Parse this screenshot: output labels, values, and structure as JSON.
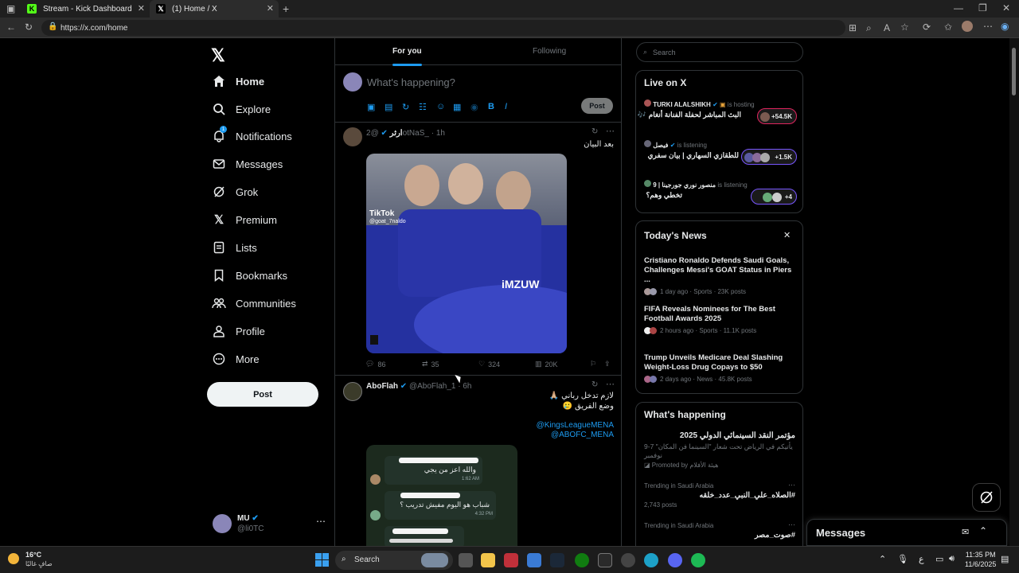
{
  "browser": {
    "tabs": [
      {
        "title": "Stream - Kick Dashboard",
        "active": false
      },
      {
        "title": "(1) Home / X",
        "active": true
      }
    ],
    "url": "https://x.com/home"
  },
  "nav": {
    "items": [
      {
        "label": "Home",
        "icon": "home-icon"
      },
      {
        "label": "Explore",
        "icon": "search-icon"
      },
      {
        "label": "Notifications",
        "icon": "bell-icon",
        "badge": "1"
      },
      {
        "label": "Messages",
        "icon": "envelope-icon"
      },
      {
        "label": "Grok",
        "icon": "grok-icon"
      },
      {
        "label": "Premium",
        "icon": "x-icon"
      },
      {
        "label": "Lists",
        "icon": "list-icon"
      },
      {
        "label": "Bookmarks",
        "icon": "bookmark-icon"
      },
      {
        "label": "Communities",
        "icon": "people-icon"
      },
      {
        "label": "Profile",
        "icon": "person-icon"
      },
      {
        "label": "More",
        "icon": "more-circle-icon"
      }
    ],
    "post_button": "Post",
    "account": {
      "name": "MU",
      "handle": "@li0TC"
    }
  },
  "feed": {
    "tabs": [
      "For you",
      "Following"
    ],
    "active_tab": "For you",
    "compose_placeholder": "What's happening?",
    "compose_post_button": "Post",
    "tweets": [
      {
        "name": "ارثر",
        "handle": "@2otNaS_",
        "time": "1h",
        "text": "بعد البيان",
        "media_overlay": [
          "TikTok",
          "@goat_7naldo",
          "iMZUW"
        ],
        "replies": "86",
        "reposts": "35",
        "likes": "324",
        "views": "20K"
      },
      {
        "name": "AboFlah",
        "handle": "@AboFlah_1",
        "time": "6h",
        "text_lines": [
          "لازم تدخل رباني 🙏🏼",
          "وضع الفريق 🥲"
        ],
        "mentions": [
          "@KingsLeagueMENA",
          "@ABOFC_MENA"
        ],
        "chat": [
          {
            "text": "والله اعز من يجي",
            "time": "1:62 AM"
          },
          {
            "text": "شباب هو اليوم مفيش تدريب ؟",
            "time": "4:32 PM"
          }
        ]
      }
    ]
  },
  "right": {
    "search_placeholder": "Search",
    "live": {
      "title": "Live on X",
      "items": [
        {
          "host": "TURKI ALALSHIKH",
          "status": "is hosting",
          "title": "البث المباشر لحفلة الفنانة أنغام 🎶",
          "count": "+54.5K"
        },
        {
          "host": "فيصل",
          "status": "is listening",
          "title": "للطقازي السهاري | بيان سفري",
          "count": "+1.5K"
        },
        {
          "host": "منصور نوري جورجينا | 9",
          "status": "is listening",
          "title": "تخطي وهم؟",
          "count": "+4"
        }
      ]
    },
    "news": {
      "title": "Today's News",
      "items": [
        {
          "title": "Cristiano Ronaldo Defends Saudi Goals, Challenges Messi's GOAT Status in Piers ...",
          "meta": "1 day ago · Sports · 23K posts"
        },
        {
          "title": "FIFA Reveals Nominees for The Best Football Awards 2025",
          "meta": "2 hours ago · Sports · 11.1K posts"
        },
        {
          "title": "Trump Unveils Medicare Deal Slashing Weight-Loss Drug Copays to $50",
          "meta": "2 days ago · News · 45.8K posts"
        }
      ]
    },
    "happening": {
      "title": "What's happening",
      "promo": {
        "title": "مؤتمر النقد السينمائي الدولي 2025",
        "desc": "يأتيكم في الرياض تحت شعار \"السينما فن المكان\" 7-9 نوفمبر",
        "promoted": "Promoted by",
        "promoter": "هيئة الأفلام"
      },
      "trends": [
        {
          "context": "Trending in Saudi Arabia",
          "tag": "#الصلاه_علي_النبي_عدد_خلقه",
          "posts": "2,743 posts"
        },
        {
          "context": "Trending in Saudi Arabia",
          "tag": "#صوت_مصر",
          "posts": ""
        }
      ]
    },
    "messages_dock": "Messages"
  },
  "taskbar": {
    "weather_temp": "16°C",
    "weather_desc": "صافٍ غالبًا",
    "search": "Search",
    "lang": "ع",
    "time": "11:35 PM",
    "date": "11/6/2025"
  }
}
